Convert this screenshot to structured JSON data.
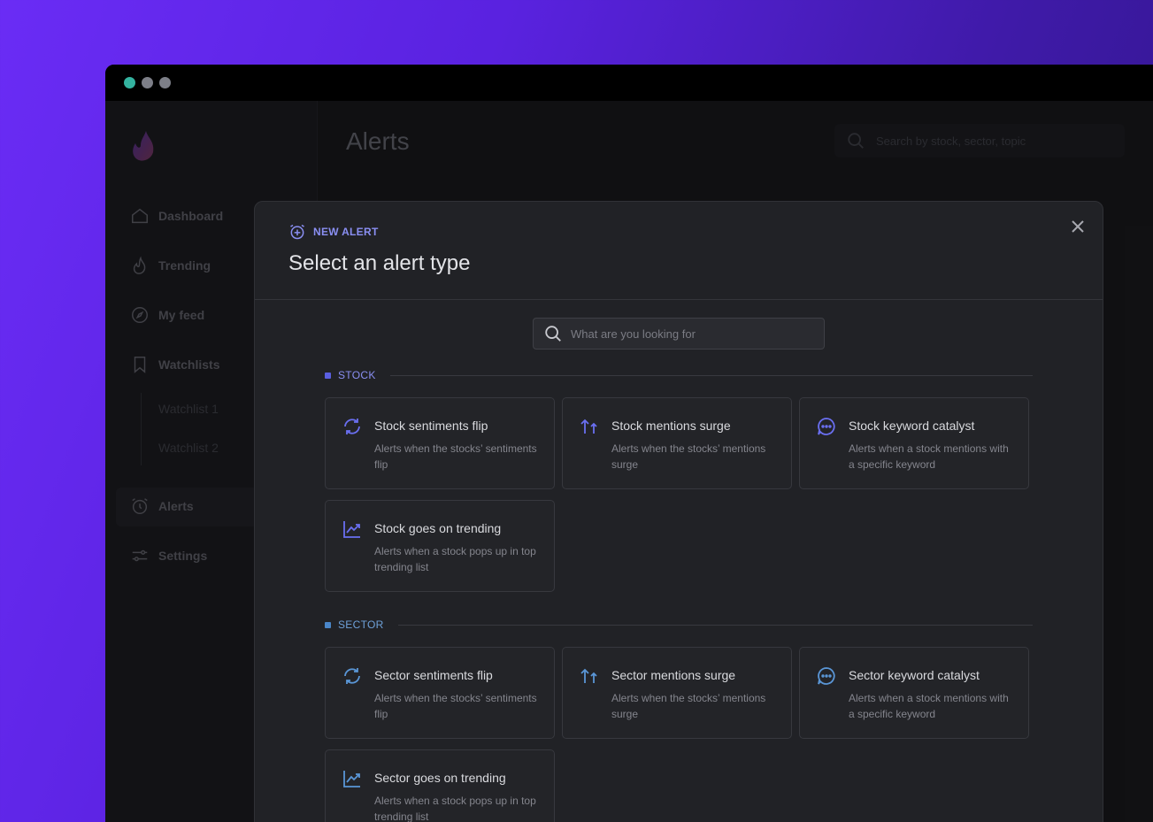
{
  "window": {
    "dots": [
      "green",
      "gray",
      "gray"
    ]
  },
  "app": {
    "page_title": "Alerts",
    "search_placeholder": "Search by stock, sector, topic"
  },
  "sidebar": {
    "items": [
      {
        "label": "Dashboard",
        "icon": "home-icon"
      },
      {
        "label": "Trending",
        "icon": "flame-icon"
      },
      {
        "label": "My feed",
        "icon": "compass-icon"
      },
      {
        "label": "Watchlists",
        "icon": "bookmark-icon"
      },
      {
        "label": "Alerts",
        "icon": "alarm-icon"
      },
      {
        "label": "Settings",
        "icon": "sliders-icon"
      }
    ],
    "sub_items": [
      "Watchlist 1",
      "Watchlist 2"
    ]
  },
  "modal": {
    "eyebrow": "NEW ALERT",
    "title": "Select an alert type",
    "search_placeholder": "What are you looking for",
    "colors": {
      "accent": "#8a8ff2",
      "stock": "#5a5fe0",
      "sector": "#4a86c8"
    },
    "sections": [
      {
        "label": "STOCK",
        "cards": [
          {
            "title": "Stock sentiments flip",
            "desc": "Alerts when the stocks’ sentiments flip",
            "icon": "refresh-icon"
          },
          {
            "title": "Stock mentions surge",
            "desc": "Alerts when the stocks’ mentions surge",
            "icon": "arrows-up-icon"
          },
          {
            "title": "Stock keyword catalyst",
            "desc": "Alerts when a stock mentions with a specific keyword",
            "icon": "chat-icon"
          },
          {
            "title": "Stock goes on trending",
            "desc": "Alerts when a stock pops up in top trending list",
            "icon": "trend-chart-icon"
          }
        ]
      },
      {
        "label": "SECTOR",
        "cards": [
          {
            "title": "Sector sentiments flip",
            "desc": "Alerts when the stocks’ sentiments flip",
            "icon": "refresh-icon"
          },
          {
            "title": "Sector mentions surge",
            "desc": "Alerts when the stocks’ mentions surge",
            "icon": "arrows-up-icon"
          },
          {
            "title": "Sector keyword catalyst",
            "desc": "Alerts when a stock mentions with a specific keyword",
            "icon": "chat-icon"
          },
          {
            "title": "Sector goes on trending",
            "desc": "Alerts when a stock pops up in top trending list",
            "icon": "trend-chart-icon"
          }
        ]
      }
    ]
  }
}
